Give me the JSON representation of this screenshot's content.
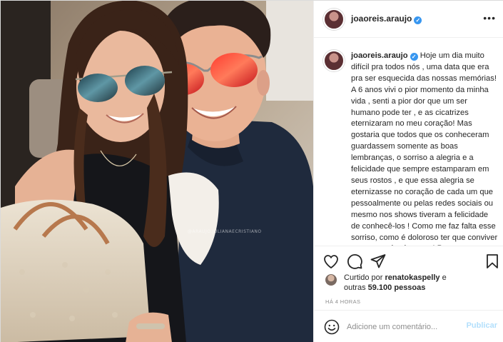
{
  "post": {
    "username": "joaoreis.araujo",
    "verified": true,
    "more_icon": "ellipsis-icon",
    "watermark": "@ARAUJO.JULIANAECRISTIANO"
  },
  "caption": {
    "username": "joaoreis.araujo",
    "text": "Hoje um dia muito difícil pra todos nós , uma data que era pra ser esquecida das nossas memórias! A 6 anos vivi o pior momento da minha vida , senti a pior dor que um ser humano pode ter , e as cicatrizes eternizaram no meu coração! Mas gostaria que todos que os conheceram guardassem somente as boas lembranças, o sorriso a alegria e a felicidade que sempre estamparam em seus rostos , e que essa alegria se eternizasse no coração de cada um que pessoalmente ou pelas redes sociais ou mesmo nos shows tiveram a felicidade de conhecê-los ! Como me faz falta esse sorriso, como é doloroso ter que conviver com essas lembranças! Peço"
  },
  "actions": {
    "icons": [
      "heart-icon",
      "comment-icon",
      "share-icon",
      "bookmark-icon"
    ]
  },
  "likes": {
    "prefix": "Curtido por ",
    "user": "renatokaspelly",
    "middle": " e",
    "others_prefix": "outras ",
    "others_count": "59.100",
    "others_suffix": " pessoas"
  },
  "timestamp": "HÁ 4 HORAS",
  "comment": {
    "placeholder": "Adicione um comentário...",
    "publish_label": "Publicar",
    "emoji_icon": "smiley-icon"
  },
  "colors": {
    "verified": "#3897f0",
    "publish_disabled": "#b2dffc",
    "muted": "#8e8e8e"
  }
}
